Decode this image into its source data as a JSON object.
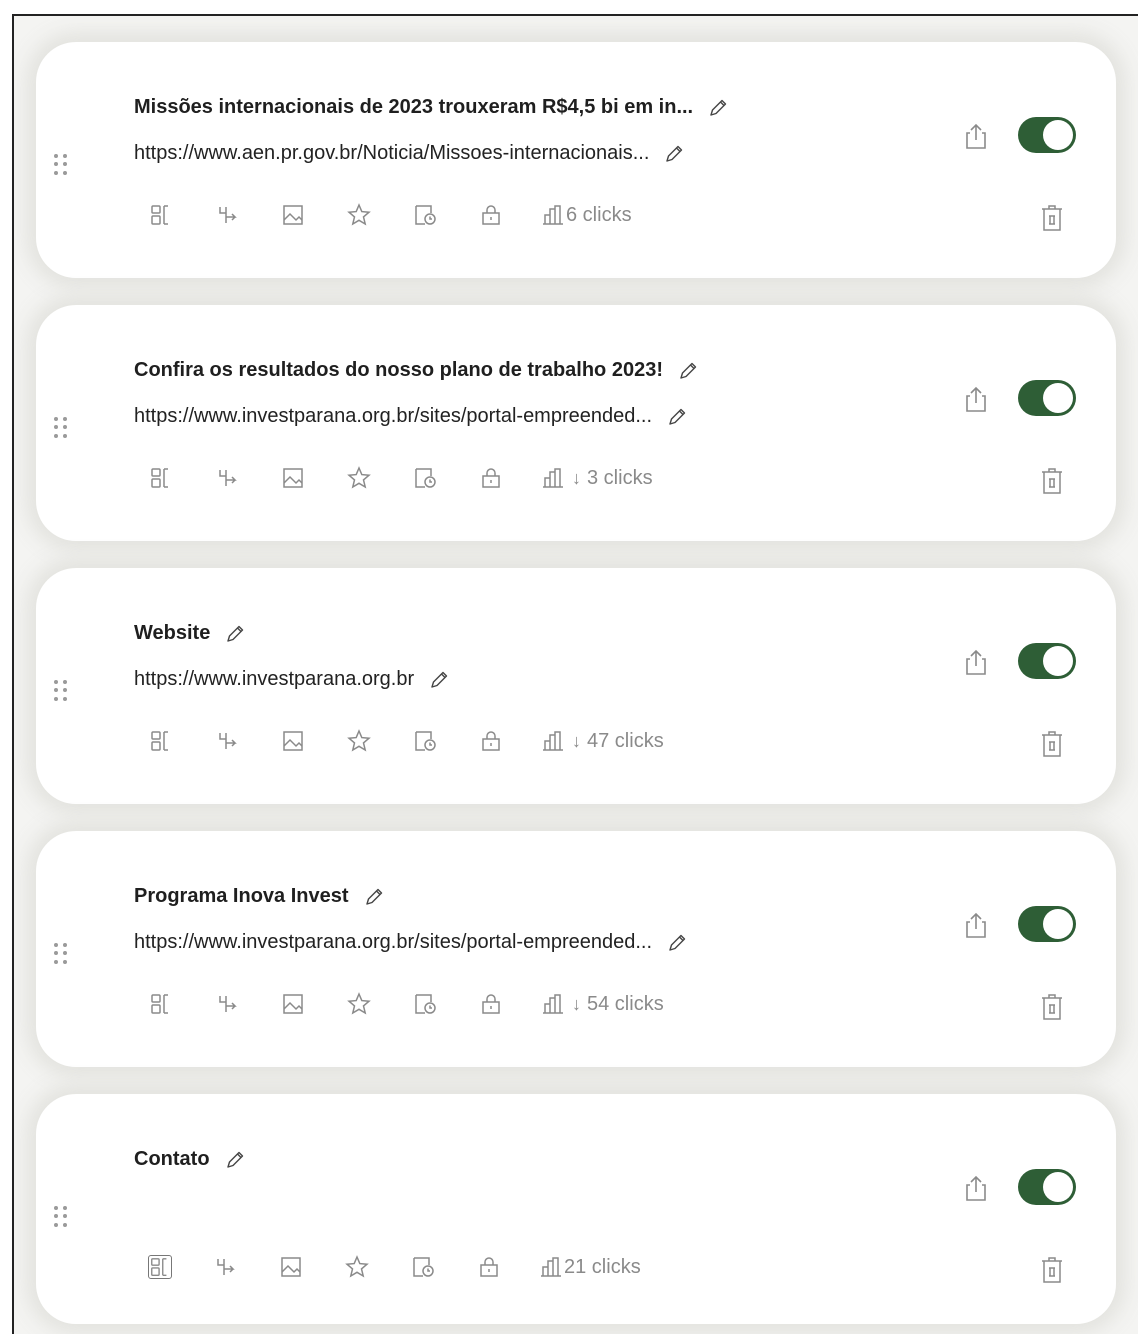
{
  "links": [
    {
      "title": "Missões internacionais de 2023 trouxeram R$4,5 bi em in...",
      "url": "https://www.aen.pr.gov.br/Noticia/Missoes-internacionais...",
      "clicks": "6 clicks",
      "has_arrow": false,
      "enabled": true
    },
    {
      "title": "Confira os resultados do nosso plano de trabalho 2023!",
      "url": "https://www.investparana.org.br/sites/portal-empreended...",
      "clicks": "3 clicks",
      "has_arrow": true,
      "enabled": true
    },
    {
      "title": "Website",
      "url": "https://www.investparana.org.br",
      "clicks": "47 clicks",
      "has_arrow": true,
      "enabled": true
    },
    {
      "title": "Programa Inova Invest",
      "url": "https://www.investparana.org.br/sites/portal-empreended...",
      "clicks": "54 clicks",
      "has_arrow": true,
      "enabled": true
    },
    {
      "title": "Contato",
      "url": "",
      "clicks": "21 clicks",
      "has_arrow": false,
      "enabled": true
    }
  ],
  "arrow_glyph": "↓",
  "colors": {
    "toggle_on": "#2e5e36",
    "icon_gray": "#8a8a8a",
    "card_bg": "#ffffff",
    "page_bg": "#f4f4f2"
  },
  "icons": {
    "toolbar": [
      "layout-icon",
      "redirect-icon",
      "thumbnail-icon",
      "star-icon",
      "schedule-icon",
      "lock-icon",
      "analytics-icon"
    ],
    "right": [
      "share-icon",
      "toggle-switch",
      "trash-icon"
    ]
  }
}
